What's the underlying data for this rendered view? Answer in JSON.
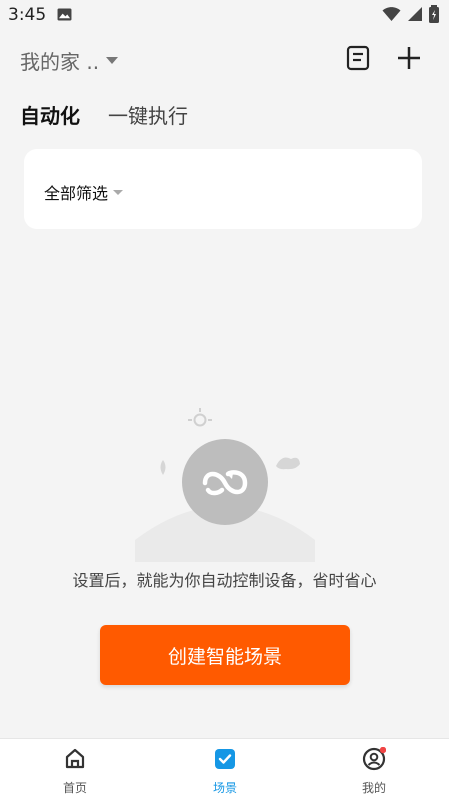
{
  "status_bar": {
    "time": "3:45"
  },
  "header": {
    "home_title": "我的家 ..",
    "icons": [
      "document-icon",
      "add-icon"
    ]
  },
  "tabs": [
    {
      "label": "自动化",
      "active": true
    },
    {
      "label": "一键执行",
      "active": false
    }
  ],
  "filter": {
    "label": "全部筛选"
  },
  "empty_state": {
    "message": "设置后，就能为你自动控制设备，省时省心"
  },
  "create_button": {
    "label": "创建智能场景"
  },
  "bottom_nav": [
    {
      "label": "首页",
      "icon": "home-icon",
      "active": false
    },
    {
      "label": "场景",
      "icon": "scene-check-icon",
      "active": true
    },
    {
      "label": "我的",
      "icon": "profile-icon",
      "active": false
    }
  ],
  "colors": {
    "accent": "#ff5a00",
    "active_nav": "#1597e5",
    "background": "#f4f4f4"
  }
}
